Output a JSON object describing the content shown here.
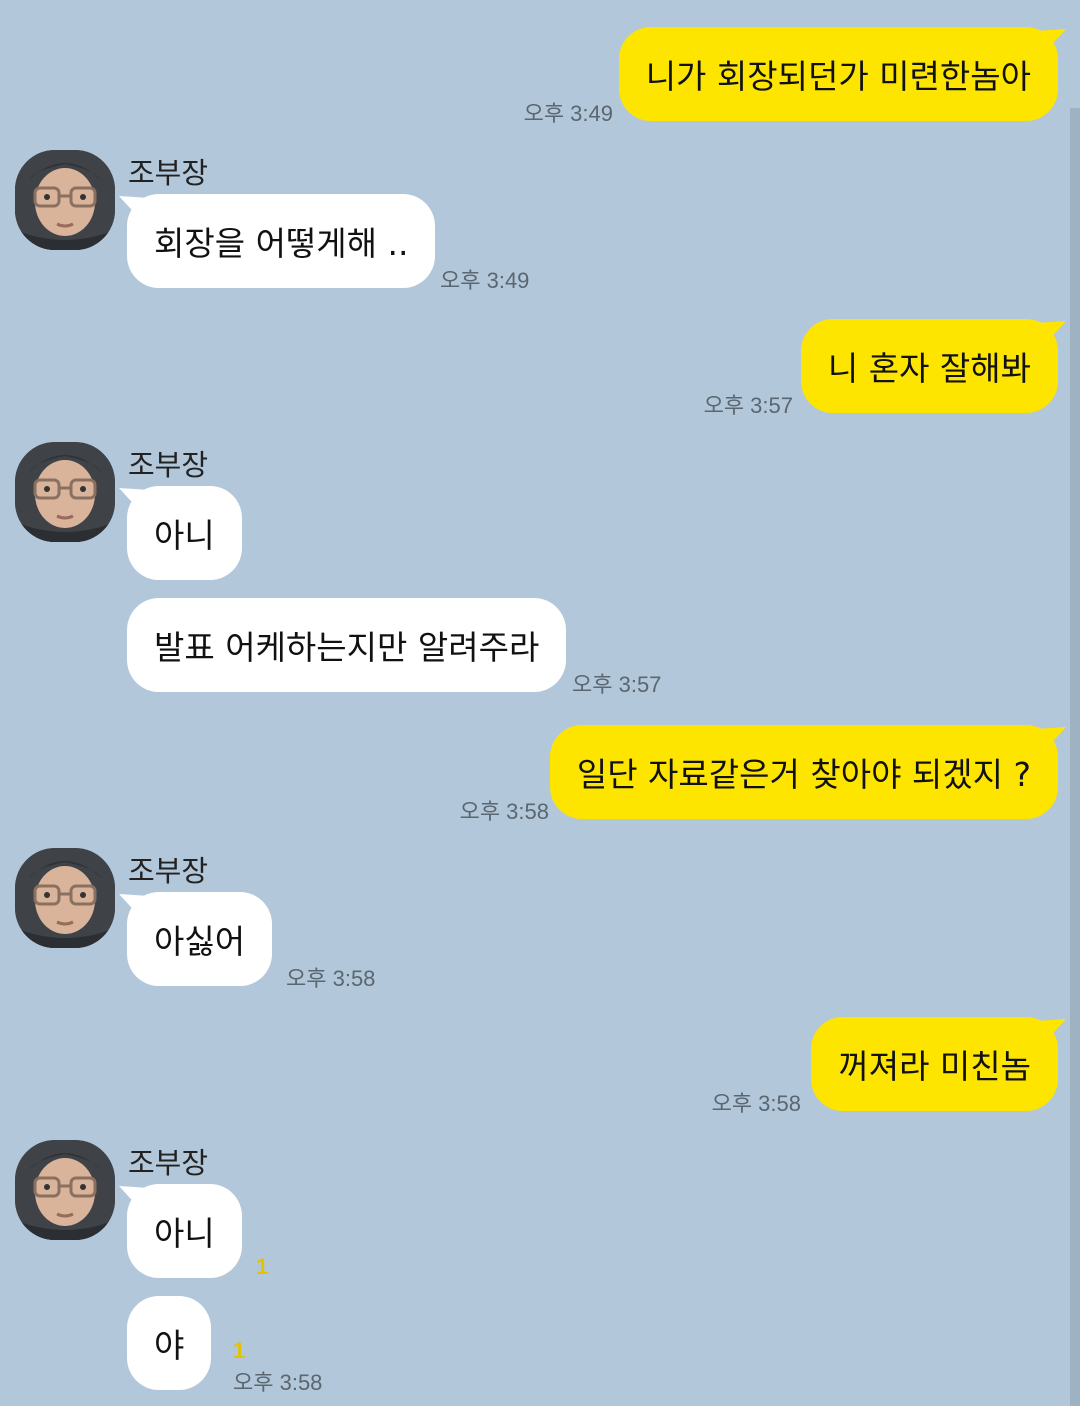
{
  "colors": {
    "background": "#b2c7da",
    "my_bubble": "#fee500",
    "their_bubble": "#ffffff",
    "unread": "#e5c200"
  },
  "contact": {
    "name": "조부장",
    "avatar_icon": "profile-photo"
  },
  "messages": [
    {
      "from": "me",
      "text": "니가 회장되던가 미련한놈아",
      "time": "오후 3:49"
    },
    {
      "from": "other",
      "text": "회장을 어떻게해 ..",
      "time": "오후 3:49"
    },
    {
      "from": "me",
      "text": "니 혼자 잘해봐",
      "time": "오후 3:57"
    },
    {
      "from": "other",
      "text": "아니",
      "time": ""
    },
    {
      "from": "other",
      "text": "발표 어케하는지만 알려주라",
      "time": "오후 3:57"
    },
    {
      "from": "me",
      "text": "일단 자료같은거 찾아야 되겠지 ?",
      "time": "오후 3:58"
    },
    {
      "from": "other",
      "text": "아싫어",
      "time": "오후 3:58"
    },
    {
      "from": "me",
      "text": "꺼져라 미친놈",
      "time": "오후 3:58"
    },
    {
      "from": "other",
      "text": "아니",
      "time": "",
      "unread": "1"
    },
    {
      "from": "other",
      "text": "야",
      "time": "오후 3:58",
      "unread": "1"
    }
  ]
}
